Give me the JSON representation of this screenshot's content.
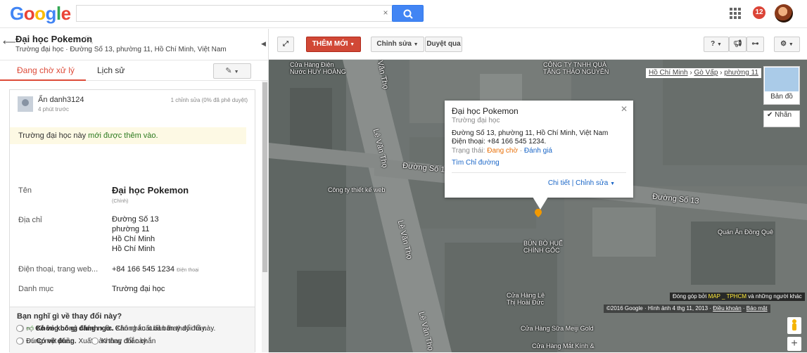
{
  "header": {
    "logo": "Google",
    "search": {
      "value": "",
      "placeholder": "",
      "clear_glyph": "×"
    },
    "notification_count": "12"
  },
  "place": {
    "title": "Đại học Pokemon",
    "subtitle": "Trường đại học · Đường Số 13, phường 11, Hồ Chí Minh, Việt Nam"
  },
  "tabs": {
    "pending": "Đang chờ xử lý",
    "history": "Lịch sử"
  },
  "edit": {
    "user": "Ẩn danh3124",
    "time": "4 phút trước",
    "count": "1 chỉnh sửa (0% đã phê duyệt)",
    "notice_prefix": "Trường đại học này ",
    "notice_highlight": "mới được thêm vào."
  },
  "fields": {
    "name_label": "Tên",
    "name_value": "Đại học Pokemon",
    "name_note": "(Chính)",
    "address_label": "Địa chỉ",
    "address_lines": [
      "Đường Số 13",
      "phường 11",
      "Hồ Chí Minh",
      "Hồ Chí Minh"
    ],
    "phone_label": "Điện thoại, trang web...",
    "phone_value": "+84 166 545 1234",
    "phone_note": "Điện thoại",
    "category_label": "Danh mục",
    "category_value": "Trường đại học"
  },
  "question": {
    "title": "Bạn nghĩ gì về thay đổi này?",
    "opt1_bold": "Không có gì đáng ngờ.",
    "opt1_rest": " Cân nhắc xuất bản thay đổi này.",
    "opt2_bold": "Có vẻ đúng.",
    "opt2_rest": " Xuất bản thay đổi này.",
    "opt3_bold": "Có vẻ không chính xác.",
    "opt3_rest": " Không xuất bản thay đổi này.",
    "opt4": "Đúng một phần",
    "opt5": "Không chắc chắn"
  },
  "toolbar": {
    "new": "THÊM MỚI",
    "edit": "Chỉnh sửa",
    "review": "Duyệt qua",
    "help": "?"
  },
  "map": {
    "breadcrumb": [
      "Hồ Chí Minh",
      "Gò Vấp",
      "phường 11"
    ],
    "minimap_label": "Bản đồ",
    "labels_ctl": "Nhãn",
    "attribution_prefix": "Đóng góp bởi ",
    "attribution_hl": "MAP _ TPHCM",
    "attribution_suffix": " và những người khác",
    "copyright": "©2016 Google",
    "imagery": "Hình ảnh 4 thg 11, 2013",
    "terms": "Điều khoản",
    "report": "Báo mật",
    "labels": {
      "store1": "Cửa Hàng Điện",
      "store1b": "Nước HUY HOÀNG",
      "store2": "CÔNG TY TNHH QUÀ",
      "store2b": "TẶNG THẢO NGUYÊN",
      "design": "Công ty thiết kế web",
      "bun": "BÚN BÒ HUẾ",
      "bun2": "CHÍNH GỐC",
      "quan": "Quán Ăn Đồng Quê",
      "le": "Cửa Hàng Lê",
      "le2": "Thị Hoài Đức",
      "meiji": "Cửa Hàng Sữa Meiji Gold",
      "matkinh": "Cửa Hàng Mắt Kính &"
    },
    "roads": {
      "levantho1": "Lê Văn Thọ",
      "levantho2": "Lê Văn Thọ",
      "levantho3": "Lê Văn Thọ",
      "levantho4": "Lê Văn Thọ",
      "duongso13a": "Đường Số 13",
      "duongso13b": "Đường Số 13"
    }
  },
  "info": {
    "title": "Đại học Pokemon",
    "category": "Trường đại học",
    "address": "Đường Số 13, phường 11, Hồ Chí Minh, Việt Nam",
    "phone": "Điện thoại: +84 166 545 1234.",
    "status_label": "Trạng thái: ",
    "status_value": "Đang chờ",
    "rate": "Đánh giá",
    "directions": "Tìm Chỉ đường",
    "links": "Chi tiết | Chỉnh sửa"
  },
  "colors": {
    "accent": "#dd4b39",
    "link": "#1a66c7",
    "search_button": "#4285f4"
  }
}
